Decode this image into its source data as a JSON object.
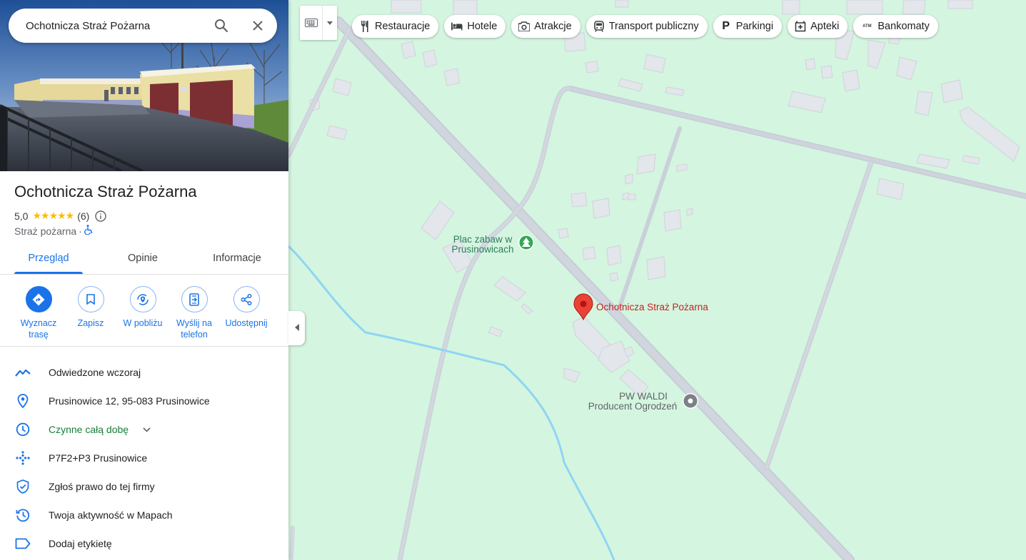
{
  "search": {
    "value": "Ochotnicza Straż Pożarna"
  },
  "place": {
    "name": "Ochotnicza Straż Pożarna",
    "rating": "5,0",
    "stars": "★★★★★",
    "review_count": "(6)",
    "category": "Straż pożarna",
    "separator": "·"
  },
  "tabs": [
    {
      "label": "Przegląd",
      "active": true
    },
    {
      "label": "Opinie"
    },
    {
      "label": "Informacje"
    }
  ],
  "actions": [
    {
      "line1": "Wyznacz",
      "line2": "trasę",
      "icon": "directions-icon"
    },
    {
      "line1": "Zapisz",
      "line2": "",
      "icon": "bookmark-icon"
    },
    {
      "line1": "W pobliżu",
      "line2": "",
      "icon": "nearby-icon"
    },
    {
      "line1": "Wyślij na",
      "line2": "telefon",
      "icon": "send-to-phone-icon"
    },
    {
      "line1": "Udostępnij",
      "line2": "",
      "icon": "share-icon"
    }
  ],
  "info": {
    "visited": "Odwiedzone wczoraj",
    "address": "Prusinowice 12, 95-083 Prusinowice",
    "hours": "Czynne całą dobę",
    "plus_code": "P7F2+P3 Prusinowice",
    "claim": "Zgłoś prawo do tej firmy",
    "activity": "Twoja aktywność w Mapach",
    "label": "Dodaj etykietę"
  },
  "chips": [
    {
      "label": "Restauracje",
      "icon": "restaurant-icon"
    },
    {
      "label": "Hotele",
      "icon": "hotel-icon"
    },
    {
      "label": "Atrakcje",
      "icon": "camera-icon"
    },
    {
      "label": "Transport publiczny",
      "icon": "transit-icon"
    },
    {
      "label": "Parkingi",
      "icon": "parking-icon"
    },
    {
      "label": "Apteki",
      "icon": "pharmacy-icon"
    },
    {
      "label": "Bankomaty",
      "icon": "atm-icon"
    }
  ],
  "map": {
    "poi_playground_line1": "Plac zabaw w",
    "poi_playground_line2": "Prusinowicach",
    "poi_selected": "Ochotnicza Straż Pożarna",
    "poi_business_line1": "PW WALDI",
    "poi_business_line2": "Producent Ogrodzeń"
  },
  "colors": {
    "accent": "#1a73e8",
    "map_bg": "#d4f5e0",
    "road": "#c9cfd9",
    "water": "#8fd5f3",
    "marker": "#ea4335",
    "open_green": "#188038"
  }
}
